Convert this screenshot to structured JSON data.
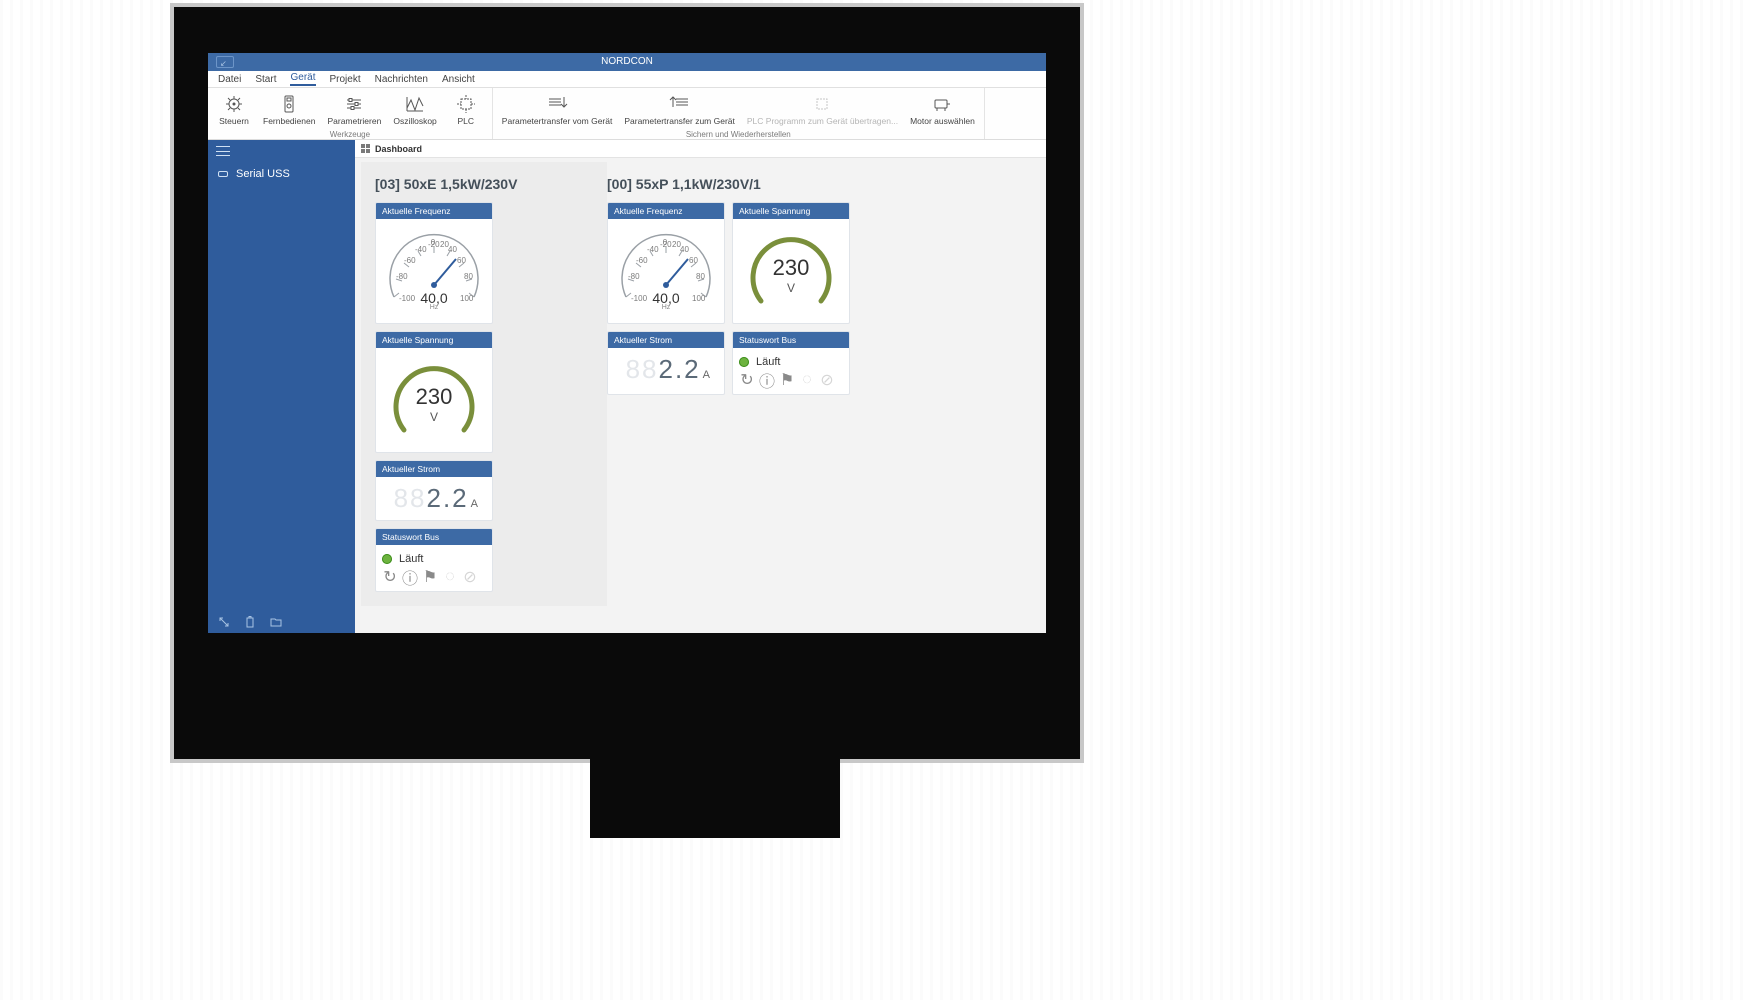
{
  "titlebar": {
    "app": "NORDCON"
  },
  "menu": [
    "Datei",
    "Start",
    "Gerät",
    "Projekt",
    "Nachrichten",
    "Ansicht"
  ],
  "menu_active": 2,
  "ribbon": {
    "groups": [
      {
        "label": "Werkzeuge",
        "buttons": [
          {
            "id": "steuern",
            "label": "Steuern"
          },
          {
            "id": "fernbedienen",
            "label": "Fernbedienen"
          },
          {
            "id": "parametrieren",
            "label": "Parametrieren"
          },
          {
            "id": "oszilloskop",
            "label": "Oszilloskop"
          },
          {
            "id": "plc",
            "label": "PLC"
          }
        ]
      },
      {
        "label": "Sichern und Wiederherstellen",
        "buttons": [
          {
            "id": "pt-vom",
            "label": "Parametertransfer\nvom Gerät"
          },
          {
            "id": "pt-zum",
            "label": "Parametertransfer\nzum Gerät"
          },
          {
            "id": "plc-prog",
            "label": "PLC Programm zum\nGerät übertragen...",
            "disabled": true
          },
          {
            "id": "motor-aus",
            "label": "Motor\nauswählen"
          }
        ]
      }
    ]
  },
  "sidebar": {
    "item": "Serial USS"
  },
  "content_tab": "Dashboard",
  "devices": [
    {
      "title": "[03] 50xE 1,5kW/230V",
      "freq": {
        "label": "Aktuelle Frequenz",
        "value": "40,0",
        "unit": "Hz",
        "needle": 40,
        "min": -100,
        "max": 100,
        "ticks": [
          -100,
          -80,
          -60,
          -40,
          -20,
          0,
          20,
          40,
          60,
          80,
          100
        ]
      },
      "volt": {
        "label": "Aktuelle Spannung",
        "value": "230",
        "unit": "V"
      },
      "curr": {
        "label": "Aktueller Strom",
        "value": "2.2",
        "unit": "A"
      },
      "status": {
        "label": "Statuswort Bus",
        "text": "Läuft"
      }
    },
    {
      "title": "[00] 55xP 1,1kW/230V/1",
      "freq": {
        "label": "Aktuelle Frequenz",
        "value": "40,0",
        "unit": "Hz",
        "needle": 40,
        "min": -100,
        "max": 100,
        "ticks": [
          -100,
          -80,
          -60,
          -40,
          -20,
          0,
          20,
          40,
          60,
          80,
          100
        ]
      },
      "volt": {
        "label": "Aktuelle Spannung",
        "value": "230",
        "unit": "V"
      },
      "curr": {
        "label": "Aktueller Strom",
        "value": "2.2",
        "unit": "A"
      },
      "status": {
        "label": "Statuswort Bus",
        "text": "Läuft"
      }
    }
  ]
}
